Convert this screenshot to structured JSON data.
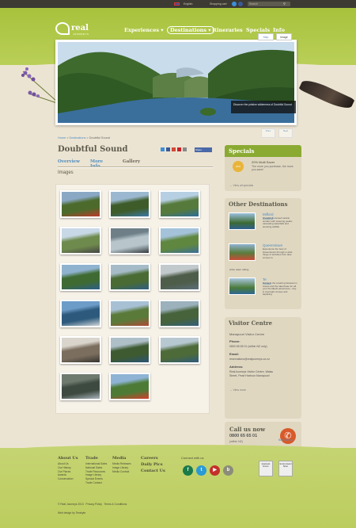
{
  "topbar": {
    "language": "English",
    "shopping_cart": "Shopping cart",
    "search_placeholder": "Search"
  },
  "logo": {
    "name": "real",
    "subtitle": "JOURNEYS"
  },
  "nav": [
    {
      "label": "Experiences ▾"
    },
    {
      "label": "Destinations ▾"
    },
    {
      "label": "Itineraries"
    },
    {
      "label": "Specials"
    },
    {
      "label": "Info"
    }
  ],
  "hero": {
    "tab_map": "Map",
    "tab_image": "Image",
    "caption": "Discover the pristine wilderness of Doubtful Sound",
    "btn_prev": "Prev",
    "btn_next": "Next"
  },
  "breadcrumb": {
    "home": "Home",
    "sep": ">",
    "destinations": "Destinations",
    "current": "Doubtful Sound"
  },
  "page": {
    "title": "Doubtful Sound",
    "share": "Share",
    "tabs": [
      "Overview",
      "More Info",
      "Gallery"
    ],
    "section_title": "Images"
  },
  "gallery": {
    "images": [
      {
        "colors": [
          "#8aa8c4",
          "#4c6a2c",
          "#c0392b"
        ]
      },
      {
        "colors": [
          "#9bb8d0",
          "#3e5c2a",
          "#3c7aa8"
        ]
      },
      {
        "colors": [
          "#b6cfe2",
          "#567a3b",
          "#2d6d9c"
        ]
      },
      {
        "colors": [
          "#c8d8e6",
          "#6f8a4d",
          "#444444"
        ]
      },
      {
        "colors": [
          "#6e7f88",
          "#b8c6cc",
          "#30383c"
        ]
      },
      {
        "colors": [
          "#a4c2da",
          "#5f8740",
          "#3b6f99"
        ]
      },
      {
        "colors": [
          "#8fb3cf",
          "#3f6b32",
          "#2c5f8a"
        ]
      },
      {
        "colors": [
          "#a6bbc8",
          "#4a6b34",
          "#2f5f83"
        ]
      },
      {
        "colors": [
          "#c2c9cc",
          "#4e5d4a",
          "#5b6e7a"
        ]
      },
      {
        "colors": [
          "#6d9cc8",
          "#2d5a7c",
          "#d0d6d9"
        ]
      },
      {
        "colors": [
          "#a7c0d4",
          "#5a7a3a",
          "#b04a36"
        ]
      },
      {
        "colors": [
          "#9bb1bb",
          "#46633b",
          "#33607d"
        ]
      },
      {
        "colors": [
          "#d9d4cc",
          "#7b6e5e",
          "#36342f"
        ]
      },
      {
        "colors": [
          "#aebfc8",
          "#3d5a31",
          "#2b5576"
        ]
      },
      {
        "colors": [
          "#b7c8d1",
          "#4d6a39",
          "#2e5b7e"
        ]
      },
      {
        "colors": [
          "#6f7a6e",
          "#3d4a40",
          "#a9b4ba"
        ]
      },
      {
        "colors": [
          "#8eb3d4",
          "#4d7b36",
          "#d23f2b"
        ]
      }
    ]
  },
  "specials": {
    "title": "Specials",
    "badge": "20%",
    "item_title": "20% Multi Saver",
    "item_desc": "The more you purchase, the more you save!",
    "view_all": "View all specials"
  },
  "other_destinations": {
    "title": "Other Destinations",
    "items": [
      {
        "name": "Milford Sound",
        "desc": "A world renowned natural wonder with towering peaks, cascading waterfalls and amazing wildlife"
      },
      {
        "name": "Queenstown",
        "desc": "Experience the best of Queenstown through a wide range of activities from lake cruises to"
      },
      {
        "name": "Te Anau",
        "desc": "Home to the amazing Glowworm Caves and the ideal base for all your Fiordland adventures - day & overnight cruises and kayaking"
      }
    ],
    "extra_text": "white water rafting."
  },
  "visitor_centre": {
    "title": "Visitor Centre",
    "name": "Manapouri Visitor Centre",
    "phone_label": "Phone:",
    "phone": "0800 65 65 01 (within NZ only)",
    "email_label": "Email:",
    "email": "reservations@realjourneys.co.nz",
    "address_label": "Address:",
    "address": "RealJourneys Visitor Centre, Waiau Street, Pearl Harbour Manapouri",
    "view_more": "View more"
  },
  "call_us": {
    "title": "Call us now",
    "number": "0800 65 65 01",
    "sub": "(within NZ)"
  },
  "back_to_top": "Back to top",
  "footer": {
    "columns": [
      {
        "heading": "About Us",
        "links": [
          "About Us",
          "Our History",
          "Our Places",
          "Awards",
          "Conservation"
        ]
      },
      {
        "heading": "Trade",
        "links": [
          "International Sales",
          "National Sales",
          "Trade Resources",
          "Image Library",
          "Special Events",
          "Trade Contact"
        ]
      },
      {
        "heading": "Media",
        "links": [
          "Media Releases",
          "Image Library",
          "Media Contact"
        ]
      },
      {
        "heading": "Careers",
        "links": []
      }
    ],
    "extra_headings": [
      "Daily Pics",
      "Contact Us"
    ],
    "connect": "Connect with us",
    "copyright": "© Real Journeys 2013",
    "privacy": "Privacy Policy",
    "terms": "Terms & Conditions",
    "credit": "Web design by Terabyte",
    "award1": "Qualmark Enviro",
    "award2": "Enviro Award Silver"
  }
}
